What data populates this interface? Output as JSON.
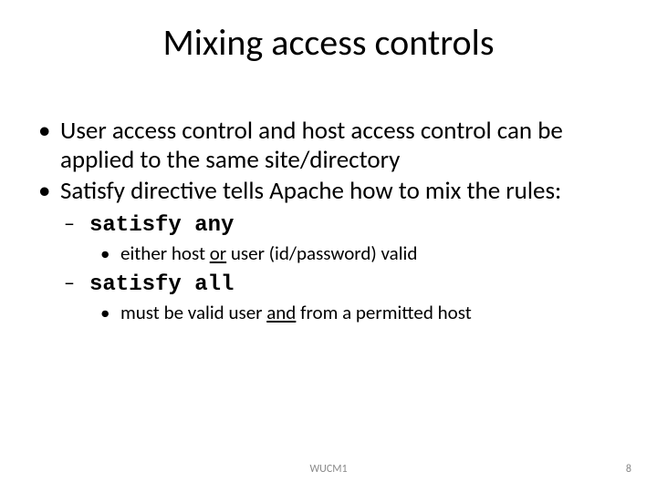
{
  "slide": {
    "title": "Mixing access controls",
    "bullets": {
      "b1": "User access control and host access control can be applied to the same site/directory",
      "b2": "Satisfy directive tells Apache how to mix the rules:",
      "sa": "satisfy any",
      "sa_sub_pre": "either host ",
      "sa_sub_or": "or",
      "sa_sub_post": " user (id/password) valid",
      "sall": "satisfy all",
      "sall_sub_pre": "must be valid user ",
      "sall_sub_and": "and",
      "sall_sub_post": " from a permitted host"
    },
    "footer": {
      "center": "WUCM1",
      "page": "8"
    }
  }
}
